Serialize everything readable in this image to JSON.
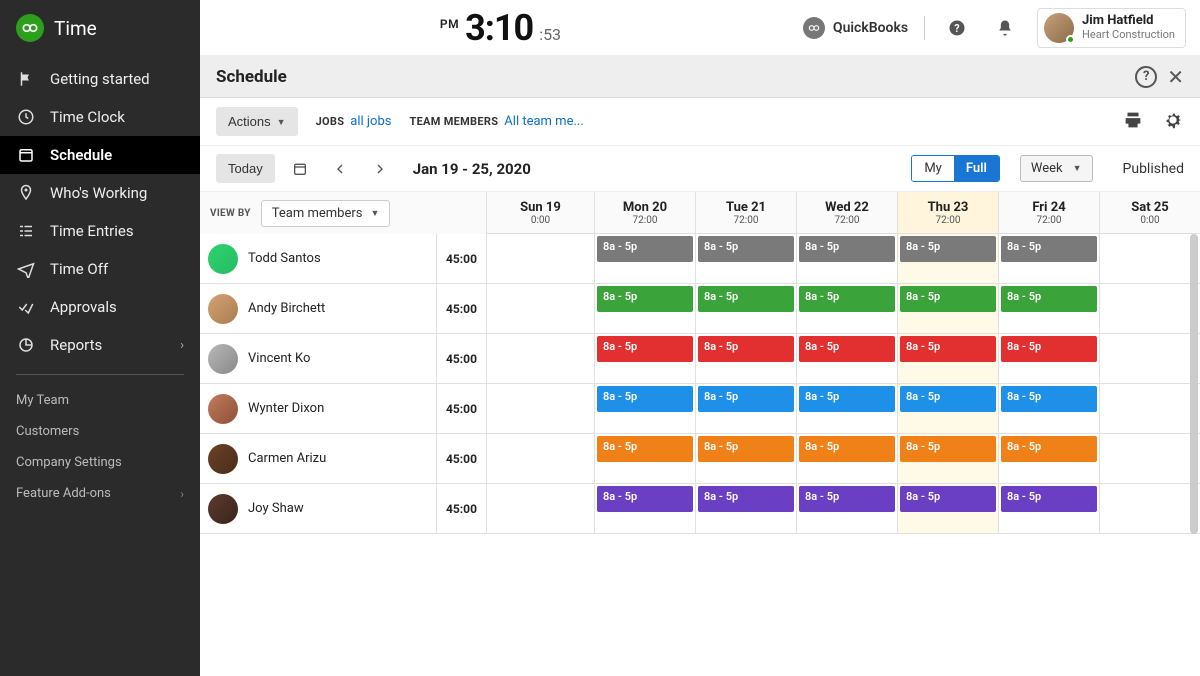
{
  "brand": {
    "name": "Time"
  },
  "nav": {
    "items": [
      {
        "label": "Getting started",
        "key": "getting-started"
      },
      {
        "label": "Time Clock",
        "key": "time-clock"
      },
      {
        "label": "Schedule",
        "key": "schedule"
      },
      {
        "label": "Who's Working",
        "key": "whos-working"
      },
      {
        "label": "Time Entries",
        "key": "time-entries"
      },
      {
        "label": "Time Off",
        "key": "time-off"
      },
      {
        "label": "Approvals",
        "key": "approvals"
      },
      {
        "label": "Reports",
        "key": "reports",
        "hasSubmenu": true
      }
    ],
    "secondary": [
      {
        "label": "My Team",
        "key": "my-team"
      },
      {
        "label": "Customers",
        "key": "customers"
      },
      {
        "label": "Company Settings",
        "key": "company-settings"
      },
      {
        "label": "Feature Add-ons",
        "key": "feature-addons",
        "hasSubmenu": true
      }
    ]
  },
  "topbar": {
    "clock": {
      "ampm": "PM",
      "hm": "3:10",
      "sec": ":53"
    },
    "quickbooks_label": "QuickBooks",
    "user": {
      "name": "Jim Hatfield",
      "org": "Heart Construction"
    }
  },
  "page": {
    "title": "Schedule"
  },
  "filter": {
    "actions_label": "Actions",
    "jobs_label": "JOBS",
    "jobs_value": "all jobs",
    "members_label": "TEAM MEMBERS",
    "members_value": "All team me..."
  },
  "datebar": {
    "today_label": "Today",
    "range": "Jan 19 - 25, 2020",
    "pill_my": "My",
    "pill_full": "Full",
    "period_label": "Week",
    "published_label": "Published"
  },
  "viewby": {
    "label": "VIEW BY",
    "value": "Team members"
  },
  "days": [
    {
      "name": "Sun 19",
      "hours": "0:00"
    },
    {
      "name": "Mon 20",
      "hours": "72:00"
    },
    {
      "name": "Tue 21",
      "hours": "72:00"
    },
    {
      "name": "Wed 22",
      "hours": "72:00"
    },
    {
      "name": "Thu 23",
      "hours": "72:00",
      "highlight": true
    },
    {
      "name": "Fri 24",
      "hours": "72:00"
    },
    {
      "name": "Sat 25",
      "hours": "0:00"
    }
  ],
  "shift_label": "8a - 5p",
  "employees": [
    {
      "name": "Todd Santos",
      "hours": "45:00",
      "color": "#7a7a7a",
      "av": "av-1"
    },
    {
      "name": "Andy Birchett",
      "hours": "45:00",
      "color": "#3aa33a",
      "av": "av-2"
    },
    {
      "name": "Vincent Ko",
      "hours": "45:00",
      "color": "#e23030",
      "av": "av-3"
    },
    {
      "name": "Wynter Dixon",
      "hours": "45:00",
      "color": "#1e90e8",
      "av": "av-4"
    },
    {
      "name": "Carmen Arizu",
      "hours": "45:00",
      "color": "#f08018",
      "av": "av-5"
    },
    {
      "name": "Joy Shaw",
      "hours": "45:00",
      "color": "#6a3fc4",
      "av": "av-6"
    }
  ]
}
